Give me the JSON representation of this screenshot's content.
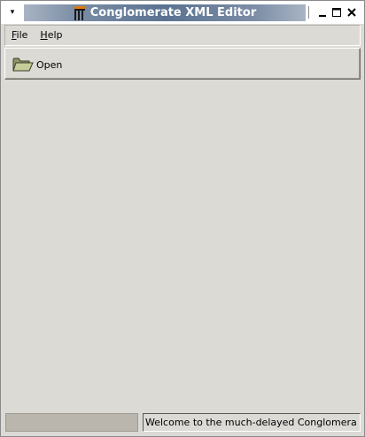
{
  "window": {
    "title": "Conglomerate XML Editor",
    "menu_glyph": "▾"
  },
  "menubar": {
    "items": [
      {
        "label": "File",
        "mnemonic": "F",
        "rest": "ile"
      },
      {
        "label": "Help",
        "mnemonic": "H",
        "rest": "elp"
      }
    ]
  },
  "toolbar": {
    "open_label": "Open",
    "open_icon": "folder-open-icon"
  },
  "statusbar": {
    "message": "Welcome to the much-delayed Conglomera"
  },
  "colors": {
    "window_bg": "#dcdad5",
    "title_gradient_mid": "#5a7291",
    "title_text": "#ffffff",
    "progress_bg": "#bab6ad",
    "folder": "#b9c08a"
  }
}
